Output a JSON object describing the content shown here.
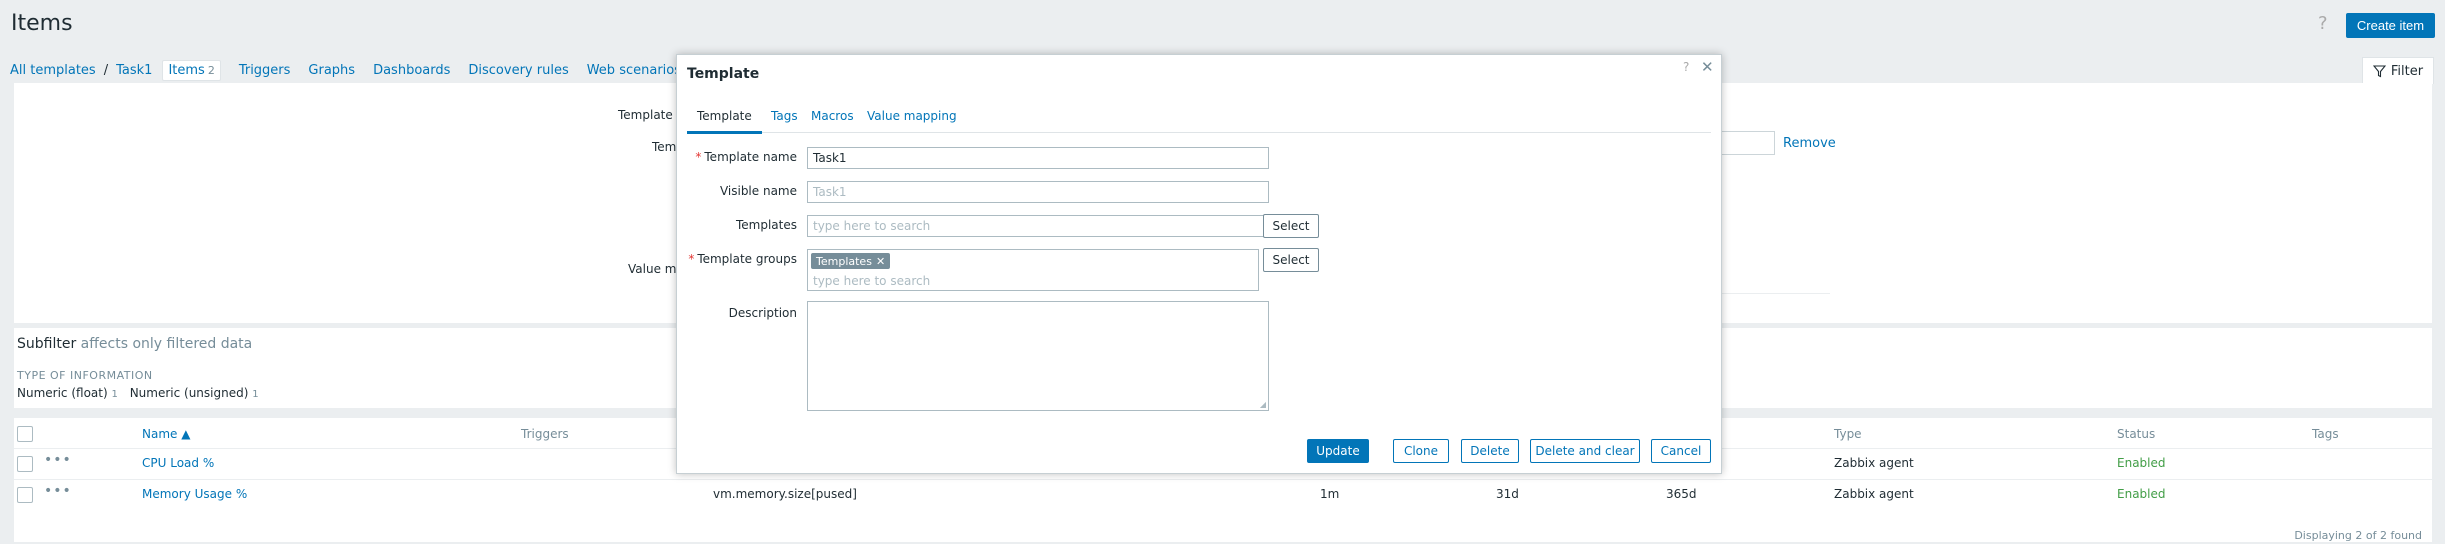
{
  "header": {
    "title": "Items",
    "help": "?",
    "create_label": "Create item"
  },
  "nav": {
    "all_templates": "All templates",
    "separator": "/",
    "template": "Task1",
    "items_label": "Items",
    "items_count": "2",
    "triggers": "Triggers",
    "graphs": "Graphs",
    "dashboards": "Dashboards",
    "discovery": "Discovery rules",
    "web": "Web scenarios"
  },
  "filter": {
    "tab_label": "Filter",
    "label_template_groups": "Template g",
    "label_templates": "Tem",
    "label_value_mapping": "Value ma",
    "remove": "Remove"
  },
  "subfilter": {
    "title": "Subfilter",
    "note": "affects only filtered data",
    "section": "TYPE OF INFORMATION",
    "values": [
      {
        "label": "Numeric (float)",
        "count": "1"
      },
      {
        "label": "Numeric (unsigned)",
        "count": "1"
      }
    ]
  },
  "table": {
    "columns": {
      "name": "Name ▲",
      "triggers": "Triggers",
      "type": "Type",
      "status": "Status",
      "tags": "Tags"
    },
    "rows": [
      {
        "name": "CPU Load %",
        "key": "",
        "interval": "",
        "history": "",
        "trends": "",
        "type": "Zabbix agent",
        "status": "Enabled"
      },
      {
        "name": "Memory Usage %",
        "key": "vm.memory.size[pused]",
        "interval": "1m",
        "history": "31d",
        "trends": "365d",
        "type": "Zabbix agent",
        "status": "Enabled"
      }
    ],
    "footer": "Displaying 2 of 2 found"
  },
  "modal": {
    "title": "Template",
    "help": "?",
    "close": "✕",
    "tabs": [
      "Template",
      "Tags",
      "Macros",
      "Value mapping"
    ],
    "fields": {
      "template_name_label": "Template name",
      "template_name_value": "Task1",
      "visible_name_label": "Visible name",
      "visible_name_placeholder": "Task1",
      "templates_label": "Templates",
      "templates_placeholder": "type here to search",
      "groups_label": "Template groups",
      "groups_chip": "Templates",
      "groups_placeholder": "type here to search",
      "description_label": "Description",
      "required_mark": "*"
    },
    "select_label": "Select",
    "buttons": {
      "update": "Update",
      "clone": "Clone",
      "delete": "Delete",
      "delete_clear": "Delete and clear",
      "cancel": "Cancel"
    }
  },
  "colors": {
    "accent": "#0275b8",
    "enabled": "#429e47",
    "required": "#e33734"
  }
}
